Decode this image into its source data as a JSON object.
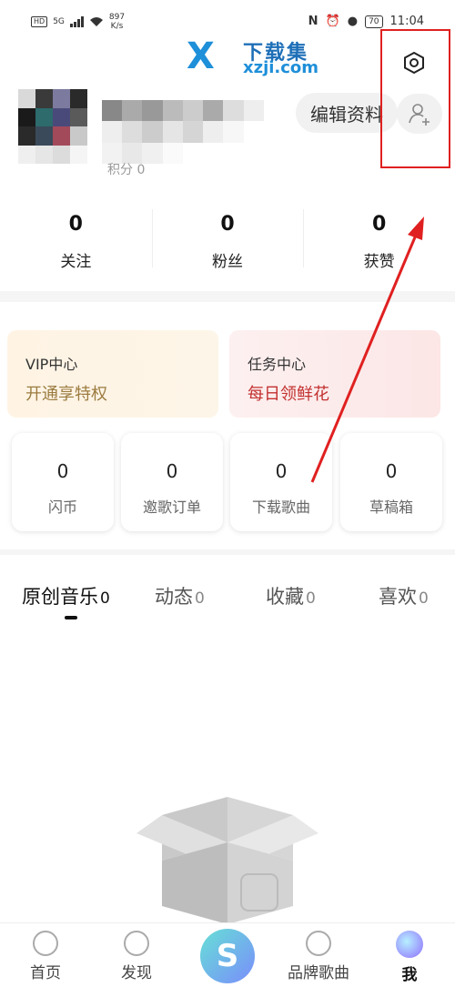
{
  "status": {
    "hd": "HD",
    "net": "5G",
    "speed": "897",
    "speed_unit": "K/s",
    "battery": "70",
    "time": "11:04"
  },
  "watermark": {
    "logo": "X",
    "cn": "下载集",
    "domain": "xzji.com"
  },
  "profile": {
    "edit_label": "编辑资料",
    "partial_text": "积分 0"
  },
  "stats": [
    {
      "value": "0",
      "label": "关注"
    },
    {
      "value": "0",
      "label": "粉丝"
    },
    {
      "value": "0",
      "label": "获赞"
    }
  ],
  "vip": {
    "title": "VIP中心",
    "sub": "开通享特权"
  },
  "task": {
    "title": "任务中心",
    "sub": "每日领鲜花"
  },
  "mini_cards": [
    {
      "value": "0",
      "label": "闪币"
    },
    {
      "value": "0",
      "label": "邀歌订单"
    },
    {
      "value": "0",
      "label": "下载歌曲"
    },
    {
      "value": "0",
      "label": "草稿箱"
    }
  ],
  "tabs": [
    {
      "label": "原创音乐",
      "count": "0"
    },
    {
      "label": "动态",
      "count": "0"
    },
    {
      "label": "收藏",
      "count": "0"
    },
    {
      "label": "喜欢",
      "count": "0"
    }
  ],
  "nav": [
    {
      "label": "首页"
    },
    {
      "label": "发现"
    },
    {
      "label": "S"
    },
    {
      "label": "品牌歌曲"
    },
    {
      "label": "我"
    }
  ],
  "colors": {
    "annotation": "#e02020",
    "vip_text": "#9b7b3f",
    "task_text": "#c2302f"
  }
}
